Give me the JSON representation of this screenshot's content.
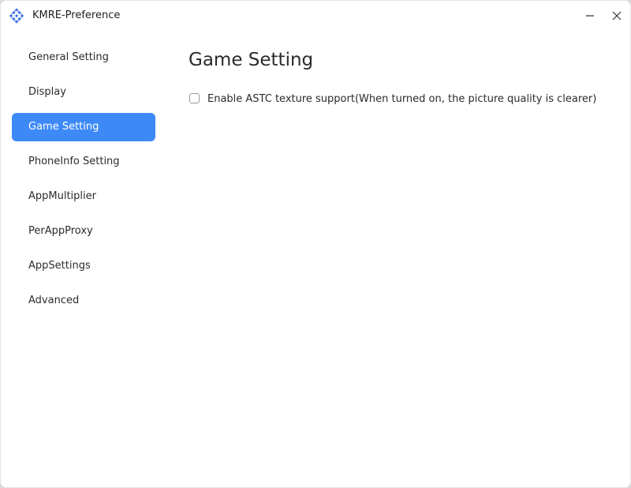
{
  "window": {
    "title": "KMRE-Preference"
  },
  "sidebar": {
    "items": [
      {
        "label": "General Setting",
        "active": false
      },
      {
        "label": "Display",
        "active": false
      },
      {
        "label": "Game Setting",
        "active": true
      },
      {
        "label": "PhoneInfo Setting",
        "active": false
      },
      {
        "label": "AppMultiplier",
        "active": false
      },
      {
        "label": "PerAppProxy",
        "active": false
      },
      {
        "label": "AppSettings",
        "active": false
      },
      {
        "label": "Advanced",
        "active": false
      }
    ]
  },
  "main": {
    "title": "Game Setting",
    "options": [
      {
        "label": "Enable ASTC texture support(When turned on, the picture quality is clearer)",
        "checked": false
      }
    ]
  },
  "colors": {
    "accent": "#3d8af7",
    "window_bg": "#ffffff",
    "text": "#2b2b2b"
  },
  "icons": {
    "app": "kmre-app-icon",
    "minimize": "minimize-icon",
    "close": "close-icon"
  }
}
